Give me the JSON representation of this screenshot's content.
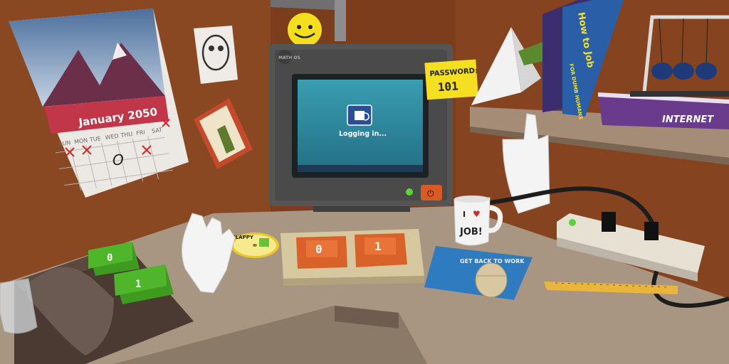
{
  "calendar": {
    "month_label": "January 2050",
    "day_headers": [
      "SUN",
      "MON",
      "TUE",
      "WED",
      "THU",
      "FRI",
      "SAT"
    ],
    "circled_mark": "O"
  },
  "monitor": {
    "brand": "MATH OS",
    "status_text": "Logging in..."
  },
  "sticky_note": {
    "line1": "PASSWORD:",
    "line2": "101"
  },
  "keyboard": {
    "key_left": "0",
    "key_right": "1"
  },
  "phone": {
    "button_top": "0",
    "button_bottom": "1"
  },
  "mug": {
    "line1": "I",
    "line2": "JOB!"
  },
  "mousepad": {
    "text": "GET BACK TO WORK"
  },
  "books": {
    "book1_title": "How to Job",
    "book1_subtitle": "FOR DUMB HUMANS",
    "book2_title": "INTERNET"
  },
  "cd": {
    "label": "FLAPPY"
  },
  "colors": {
    "wall": "#8a4520",
    "desk": "#a79580",
    "monitor_body": "#4a4a4a",
    "screen": "#2f8ba0",
    "key": "#d9622b",
    "phone_button": "#4fb52a",
    "sticky": "#f4e021",
    "mousepad": "#2f7bbf"
  }
}
